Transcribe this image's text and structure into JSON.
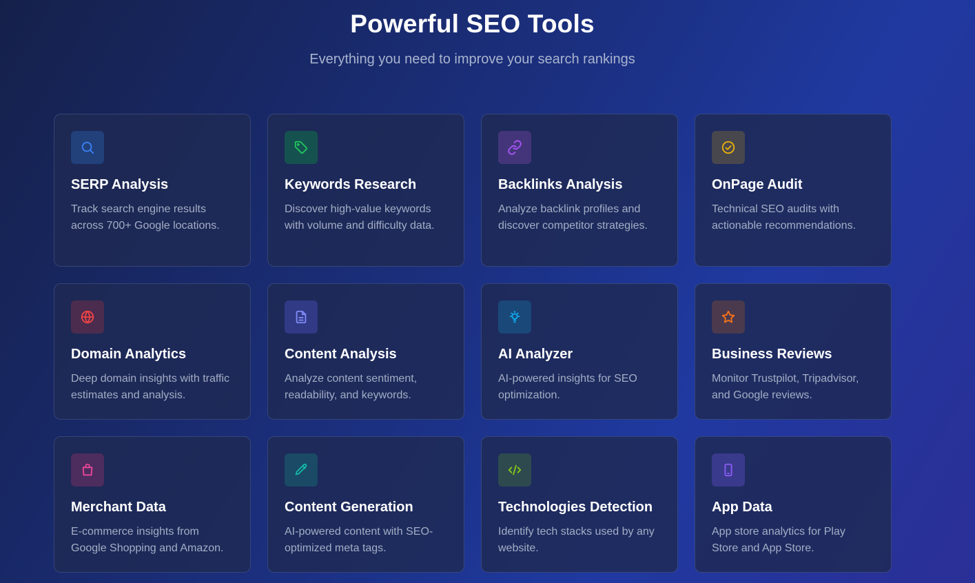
{
  "header": {
    "title": "Powerful SEO Tools",
    "subtitle": "Everything you need to improve your search rankings"
  },
  "cards": [
    {
      "title": "SERP Analysis",
      "description": "Track search engine results across 700+ Google locations.",
      "icon": "search-icon",
      "icon_color": "#3b82f6",
      "icon_bg": "#22407a"
    },
    {
      "title": "Keywords Research",
      "description": "Discover high-value keywords with volume and difficulty data.",
      "icon": "tag-icon",
      "icon_color": "#22c55e",
      "icon_bg": "#15524f"
    },
    {
      "title": "Backlinks Analysis",
      "description": "Analyze backlink profiles and discover competitor strategies.",
      "icon": "link-icon",
      "icon_color": "#a855f7",
      "icon_bg": "#44357a"
    },
    {
      "title": "OnPage Audit",
      "description": "Technical SEO audits with actionable recommendations.",
      "icon": "check-circle-icon",
      "icon_color": "#eab308",
      "icon_bg": "#48474e"
    },
    {
      "title": "Domain Analytics",
      "description": "Deep domain insights with traffic estimates and analysis.",
      "icon": "globe-icon",
      "icon_color": "#ef4444",
      "icon_bg": "#4c2c4e"
    },
    {
      "title": "Content Analysis",
      "description": "Analyze content sentiment, readability, and keywords.",
      "icon": "document-icon",
      "icon_color": "#818cf8",
      "icon_bg": "#303a85"
    },
    {
      "title": "AI Analyzer",
      "description": "AI-powered insights for SEO optimization.",
      "icon": "lightbulb-icon",
      "icon_color": "#0ea5e9",
      "icon_bg": "#1a4878"
    },
    {
      "title": "Business Reviews",
      "description": "Monitor Trustpilot, Tripadvisor, and Google reviews.",
      "icon": "star-icon",
      "icon_color": "#f97316",
      "icon_bg": "#4b3a4d"
    },
    {
      "title": "Merchant Data",
      "description": "E-commerce insights from Google Shopping and Amazon.",
      "icon": "shopping-bag-icon",
      "icon_color": "#ec4899",
      "icon_bg": "#4d2c5e"
    },
    {
      "title": "Content Generation",
      "description": "AI-powered content with SEO-optimized meta tags.",
      "icon": "pencil-icon",
      "icon_color": "#14b8a6",
      "icon_bg": "#1a4a66"
    },
    {
      "title": "Technologies Detection",
      "description": "Identify tech stacks used by any website.",
      "icon": "code-icon",
      "icon_color": "#84cc16",
      "icon_bg": "#2e4a4f"
    },
    {
      "title": "App Data",
      "description": "App store analytics for Play Store and App Store.",
      "icon": "smartphone-icon",
      "icon_color": "#8b5cf6",
      "icon_bg": "#3a3a8c"
    }
  ]
}
